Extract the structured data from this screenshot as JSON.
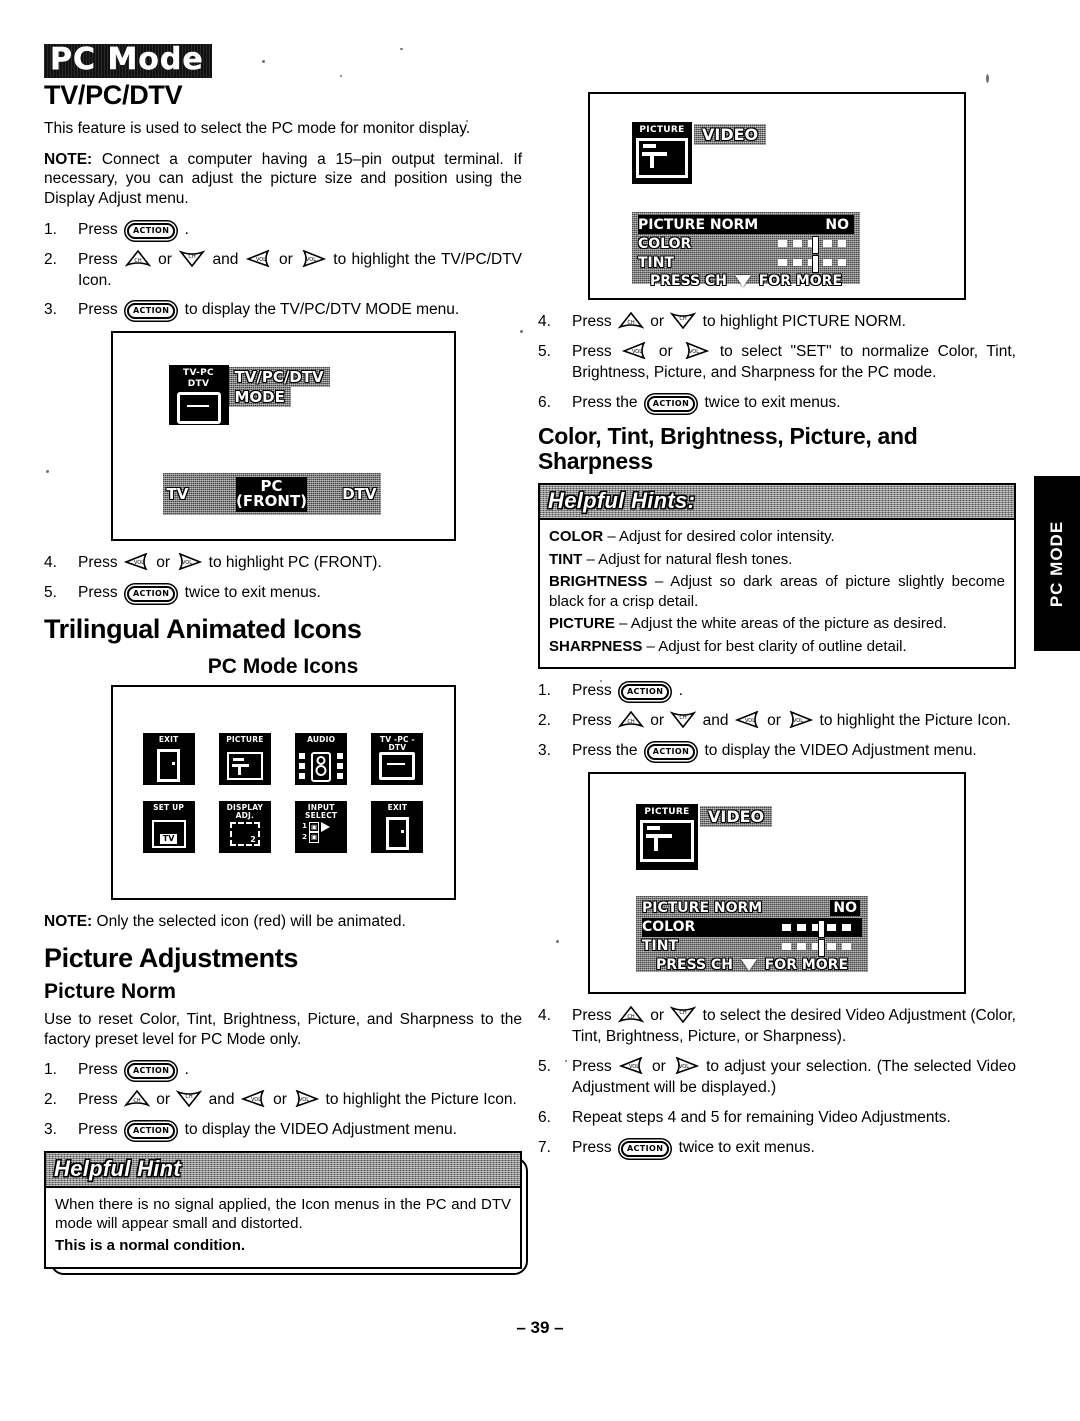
{
  "document": {
    "banner_title": "PC Mode",
    "page_number": "– 39 –",
    "side_tab": "PC MODE"
  },
  "left_column": {
    "heading_tvpcdtv": "TV/PC/DTV",
    "intro": "This feature is used to select the PC mode for monitor display.",
    "note_label": "NOTE:",
    "note_text": " Connect a computer having a 15–pin output terminal. If necessary, you can adjust the picture size and position using the Display Adjust menu.",
    "steps_a": [
      {
        "num": "1.",
        "pre": "Press ",
        "key1": "ACTION",
        "post": " ."
      },
      {
        "num": "2.",
        "pre": "Press ",
        "post": " to highlight the TV/PC/DTV Icon."
      },
      {
        "num": "3.",
        "pre": "Press ",
        "key1": "ACTION",
        "post": " to display the TV/PC/DTV MODE menu."
      }
    ],
    "osd_tvpcdtv": {
      "icon_caption_line1": "TV-PC",
      "icon_caption_line2": "DTV",
      "menu_title_line1": "TV/PC/DTV",
      "menu_title_line2": "MODE",
      "bar_left": "TV",
      "bar_center_line1": "PC",
      "bar_center_line2": "(FRONT)",
      "bar_right": "DTV"
    },
    "steps_b": [
      {
        "num": "4.",
        "pre": "Press ",
        "post": " to highlight PC (FRONT)."
      },
      {
        "num": "5.",
        "pre": "Press ",
        "key1": "ACTION",
        "post": " twice to exit menus."
      }
    ],
    "heading_trilingual": "Trilingual Animated Icons",
    "heading_pcmodeicons": "PC Mode Icons",
    "icons": [
      {
        "caption": "EXIT",
        "art": "door"
      },
      {
        "caption": "PICTURE",
        "art": "picture"
      },
      {
        "caption": "AUDIO",
        "art": "audio"
      },
      {
        "caption_line1": "TV -PC -",
        "caption_line2": "DTV",
        "art": "tvset"
      },
      {
        "caption": "SET UP",
        "art": "setup",
        "art_label": "TV"
      },
      {
        "caption_line1": "DISPLAY",
        "caption_line2": "ADJ.",
        "art": "dispadj"
      },
      {
        "caption_line1": "INPUT",
        "caption_line2": "SELECT",
        "art": "inputselect",
        "input_1": "1",
        "input_2": "2"
      },
      {
        "caption": "EXIT",
        "art": "door"
      }
    ],
    "note2_label": "NOTE:",
    "note2_text": " Only the selected icon (red) will be animated.",
    "heading_picture_adjustments": "Picture Adjustments",
    "heading_picture_norm": "Picture Norm",
    "picture_norm_text": "Use to reset Color, Tint, Brightness, Picture, and Sharpness to the factory preset level for PC Mode only.",
    "steps_c": [
      {
        "num": "1.",
        "pre": "Press ",
        "key1": "ACTION",
        "post": " ."
      },
      {
        "num": "2.",
        "pre": "Press ",
        "post": " to highlight the Picture Icon."
      },
      {
        "num": "3.",
        "pre": "Press ",
        "key1": "ACTION",
        "post": " to display the VIDEO Adjustment menu."
      }
    ],
    "hint": {
      "title": "Helpful Hint",
      "line1": "When there is no signal applied, the Icon menus in the PC and DTV mode will appear small and distorted.",
      "line2_bold": "This is a normal condition."
    }
  },
  "right_column": {
    "osd_video_1": {
      "icon_caption": "PICTURE",
      "menu_title": "VIDEO",
      "rows": [
        {
          "label": "PICTURE NORM",
          "value": "NO",
          "highlighted": true,
          "slider": false
        },
        {
          "label": "COLOR",
          "highlighted": false,
          "slider": true
        },
        {
          "label": "TINT",
          "highlighted": false,
          "slider": true
        }
      ],
      "footer_pre": "PRESS CH ",
      "footer_post": " FOR MORE"
    },
    "steps_d": [
      {
        "num": "4.",
        "pre": "Press ",
        "post": " to highlight PICTURE NORM."
      },
      {
        "num": "5.",
        "pre": "Press ",
        "post": " to select \"SET\" to normalize Color, Tint, Brightness, Picture, and Sharpness for the PC mode."
      },
      {
        "num": "6.",
        "pre": "Press the ",
        "key1": "ACTION",
        "post": " twice to exit menus."
      }
    ],
    "heading_cts": "Color, Tint, Brightness, Picture, and Sharpness",
    "hints": {
      "title": "Helpful Hints:",
      "items": [
        {
          "term": "COLOR",
          "desc": " – Adjust for desired color intensity."
        },
        {
          "term": "TINT",
          "desc": " – Adjust for natural flesh tones."
        },
        {
          "term": "BRIGHTNESS",
          "desc": " – Adjust so dark areas of picture slightly become black for a crisp detail."
        },
        {
          "term": "PICTURE",
          "desc": " – Adjust the white areas of the picture as desired."
        },
        {
          "term": "SHARPNESS",
          "desc": " – Adjust for best clarity of outline detail."
        }
      ]
    },
    "steps_e": [
      {
        "num": "1.",
        "pre": "Press ",
        "key1": "ACTION",
        "post": " ."
      },
      {
        "num": "2.",
        "pre": "Press ",
        "post": " to highlight the Picture Icon."
      },
      {
        "num": "3.",
        "pre": "Press the ",
        "key1": "ACTION",
        "post": " to display the VIDEO Adjustment menu."
      }
    ],
    "osd_video_2": {
      "icon_caption": "PICTURE",
      "menu_title": "VIDEO",
      "rows": [
        {
          "label": "PICTURE NORM",
          "value": "NO",
          "highlighted": false,
          "slider": false
        },
        {
          "label": "COLOR",
          "highlighted": true,
          "slider": true
        },
        {
          "label": "TINT",
          "highlighted": false,
          "slider": true
        }
      ],
      "footer_pre": "PRESS CH ",
      "footer_post": " FOR MORE"
    },
    "steps_f": [
      {
        "num": "4.",
        "pre": "Press ",
        "post": " to select the desired Video Adjustment (Color, Tint, Brightness, Picture, or Sharpness)."
      },
      {
        "num": "5.",
        "pre": "Press ",
        "post": " to adjust your selection.  (The selected Video Adjustment will be displayed.)"
      },
      {
        "num": "6.",
        "text": "Repeat steps 4 and 5 for remaining Video Adjustments."
      },
      {
        "num": "7.",
        "pre": "Press ",
        "key1": "ACTION",
        "post": " twice to exit menus."
      }
    ]
  },
  "keys": {
    "action": "ACTION",
    "ch_up": "CH",
    "ch_down": "CH",
    "vol_left": "VOL",
    "vol_right": "VOL",
    "or": " or ",
    "and": " and "
  }
}
